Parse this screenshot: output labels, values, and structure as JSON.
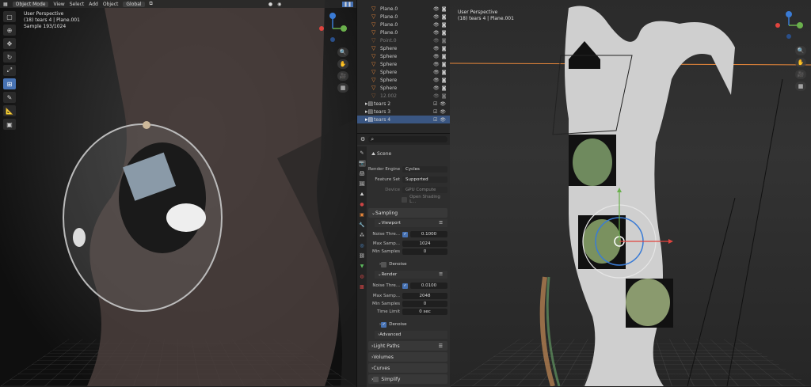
{
  "left_viewport": {
    "header": {
      "mode": "Object Mode",
      "menus": [
        "View",
        "Select",
        "Add",
        "Object"
      ],
      "orientation": "Global"
    },
    "overlay": {
      "perspective": "User Perspective",
      "object": "(18) tears 4 | Plane.001",
      "samples": "Sample 193/1024"
    }
  },
  "right_viewport": {
    "overlay": {
      "perspective": "User Perspective",
      "object": "(18) tears 4 | Plane.001"
    }
  },
  "outliner": {
    "rows": [
      {
        "name": "Plane.0"
      },
      {
        "name": "Plane.0"
      },
      {
        "name": "Plane.0"
      },
      {
        "name": "Plane.0"
      },
      {
        "name": "Point.0"
      },
      {
        "name": "Sphere"
      },
      {
        "name": "Sphere"
      },
      {
        "name": "Sphere"
      },
      {
        "name": "Sphere"
      },
      {
        "name": "Sphere"
      },
      {
        "name": "Sphere"
      },
      {
        "name": "12.002"
      }
    ],
    "collections": [
      {
        "name": "tears 2"
      },
      {
        "name": "tears 3"
      },
      {
        "name": "tears 4"
      }
    ]
  },
  "properties": {
    "scene_label": "Scene",
    "render_engine": {
      "label": "Render Engine",
      "value": "Cycles"
    },
    "feature_set": {
      "label": "Feature Set",
      "value": "Supported"
    },
    "device": {
      "label": "Device",
      "value": "GPU Compute"
    },
    "open_shading": "Open Shading L...",
    "sampling": "Sampling",
    "viewport": {
      "title": "Viewport",
      "noise_threshold": {
        "label": "Noise Thre...",
        "value": "0.1000"
      },
      "max_samples": {
        "label": "Max Samp...",
        "value": "1024"
      },
      "min_samples": {
        "label": "Min Samples",
        "value": "0"
      },
      "denoise": "Denoise"
    },
    "render": {
      "title": "Render",
      "noise_threshold": {
        "label": "Noise Thre...",
        "value": "0.0100"
      },
      "max_samples": {
        "label": "Max Samp...",
        "value": "2048"
      },
      "min_samples": {
        "label": "Min Samples",
        "value": "0"
      },
      "time_limit": {
        "label": "Time Limit",
        "value": "0 sec"
      },
      "denoise": "Denoise"
    },
    "advanced": "Advanced",
    "light_paths": "Light Paths",
    "volumes": "Volumes",
    "curves": "Curves",
    "simplify": "Simplify"
  },
  "colors": {
    "accent": "#4772b3",
    "selected_row": "#3a5682",
    "object_icon": "#e8873a",
    "axis_x": "#e0443e",
    "axis_y": "#6ab04c",
    "axis_z": "#3a7bd5"
  }
}
